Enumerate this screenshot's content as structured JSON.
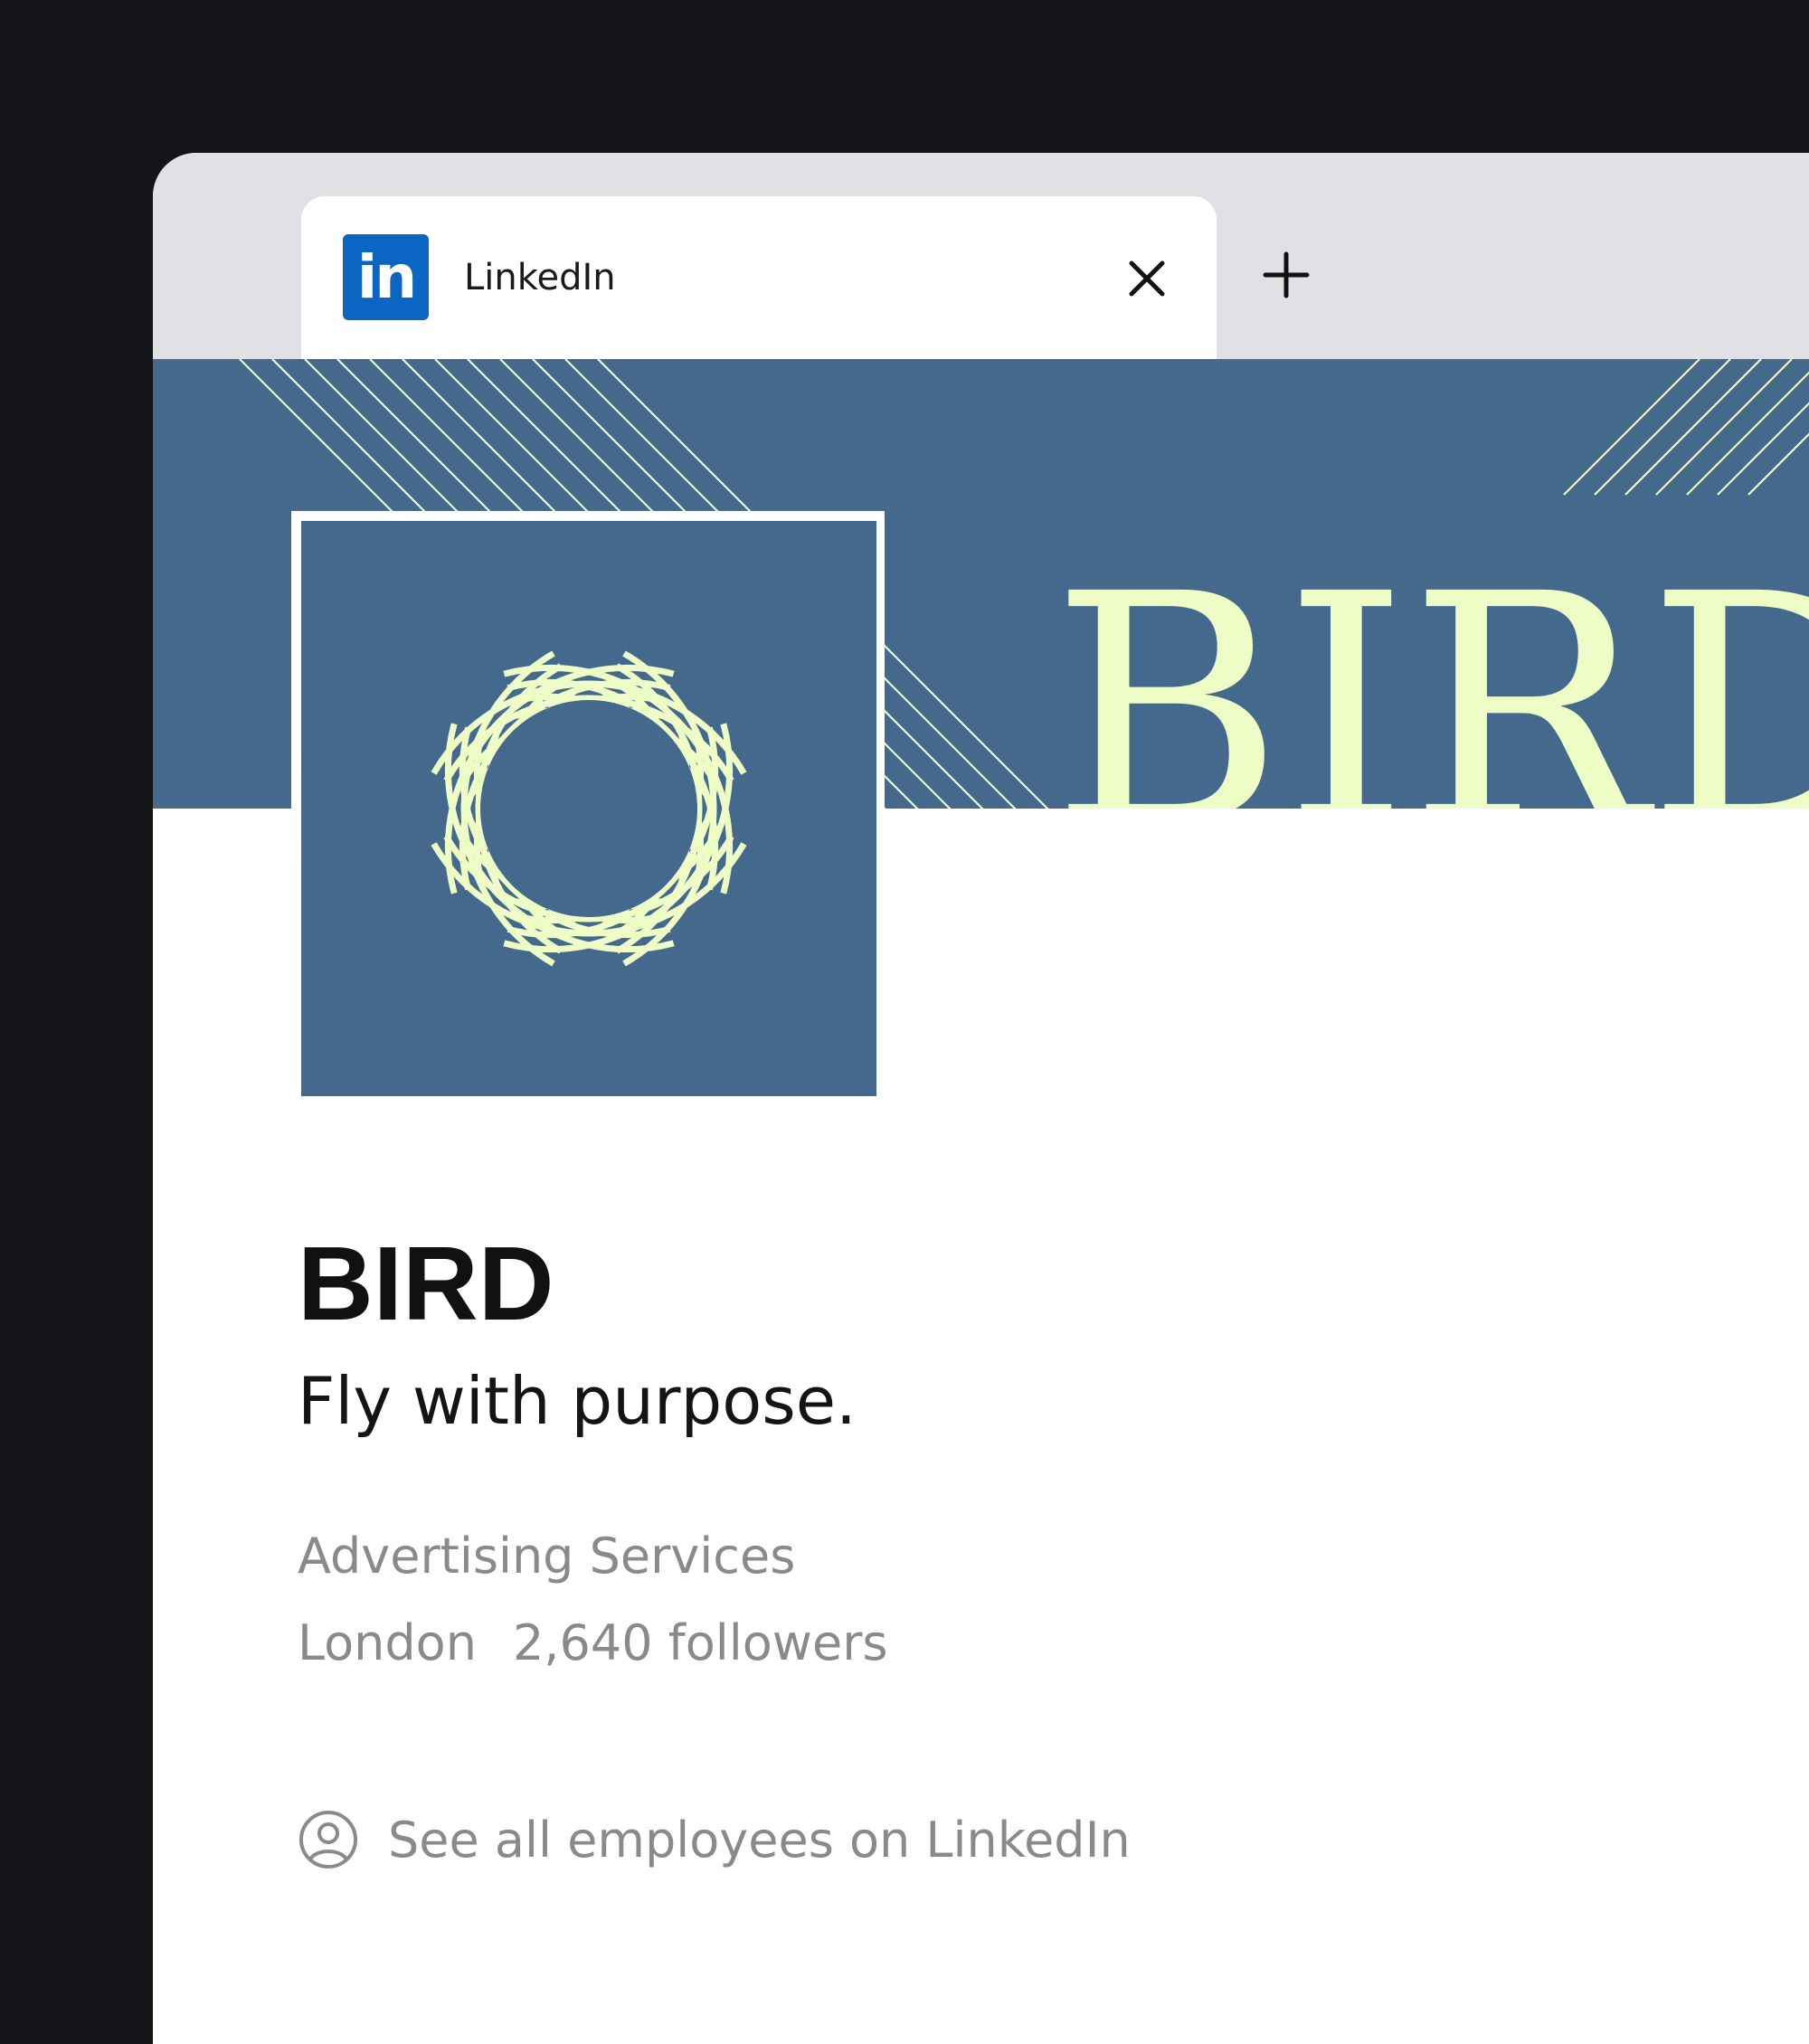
{
  "browser": {
    "tab": {
      "favicon": "linkedin-icon",
      "favicon_text": "in",
      "title": "LinkedIn"
    },
    "icons": {
      "close": "close-icon",
      "new_tab": "plus-icon"
    }
  },
  "company": {
    "banner_text": "BIRD",
    "name": "BIRD",
    "tagline": "Fly with purpose.",
    "industry": "Advertising Services",
    "location": "London",
    "followers": "2,640 followers",
    "employees_link": "See all employees on LinkedIn"
  },
  "colors": {
    "brand_blue": "#44698c",
    "brand_cream": "#eefcc6",
    "linkedin_blue": "#0a66c2"
  }
}
